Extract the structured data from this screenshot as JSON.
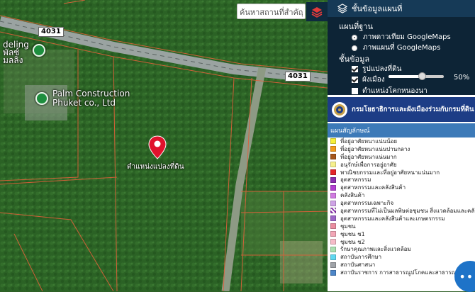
{
  "map": {
    "poi1": "deling\nพัลซ์\nมลลิง",
    "poi2_line1": "Palm Construction",
    "poi2_line2": "Phuket co., Ltd",
    "road_shield_1": "4031",
    "road_shield_2": "4031",
    "marker_label": "ตำแหน่งแปลงที่ดิน",
    "marker_color": "#e0122c"
  },
  "search": {
    "placeholder": "ค้นหาสถานที่สำคัญ"
  },
  "panel": {
    "header_title": "ชั้นข้อมูลแผนที่",
    "basemap_title": "แผนที่ฐาน",
    "basemap_options": [
      "ภาพดาวเทียม GoogleMaps",
      "ภาพแผนที่ GoogleMaps"
    ],
    "basemap_selected": 0,
    "data_title": "ชั้นข้อมูล",
    "layers": [
      {
        "label": "รูปแปลงที่ดิน",
        "checked": true
      },
      {
        "label": "ผังเมือง",
        "checked": true
      },
      {
        "label": "ตำแหน่งโคกหนองนา",
        "checked": false
      }
    ],
    "opacity_value": "50%",
    "opacity_fraction": 0.6,
    "dept_banner": "กรมโยธาธิการและผังเมืองร่วมกับกรมที่ดิน",
    "legend_title": "แผนสัญลักษณ์",
    "legend": [
      {
        "label": "ที่อยู่อาศัยหนาแน่นน้อย",
        "color": "#f6ef3a"
      },
      {
        "label": "ที่อยู่อาศัยหนาแน่นปานกลาง",
        "color": "#f29a1e"
      },
      {
        "label": "ที่อยู่อาศัยหนาแน่นมาก",
        "color": "#a5561b"
      },
      {
        "label": "อนุรักษ์เพื่อการอยู่อาศัย",
        "color": "#f6f08c"
      },
      {
        "label": "พาณิชยกรรมและที่อยู่อาศัยหนาแน่นมาก",
        "color": "#e3262b"
      },
      {
        "label": "อุตสาหกรรม",
        "color": "#8a2fb0"
      },
      {
        "label": "อุตสาหกรรมและคลังสินค้า",
        "color": "#b23fd1"
      },
      {
        "label": "คลังสินค้า",
        "color": "#d07ae0"
      },
      {
        "label": "อุตสาหกรรมเฉพาะกิจ",
        "color": "#cfa3e6"
      },
      {
        "label": "อุตสาหกรรมที่ไม่เป็นมลพิษต่อชุมชน สิ่งแวดล้อมและคลังสินค้า",
        "color": "#c07be0"
      },
      {
        "label": "อุตสาหกรรมและคลังสินค้าและเกษตรกรรม",
        "color": "#9c66c7"
      },
      {
        "label": "ชุมชน",
        "color": "#ea8da0"
      },
      {
        "label": "ชุมชน ช1",
        "color": "#f2a6b6"
      },
      {
        "label": "ชุมชน ช2",
        "color": "#f5bcc8"
      },
      {
        "label": "รักษาคุณภาพและสิ่งแวดล้อม",
        "color": "#a9e0b0"
      },
      {
        "label": "สถาบันการศึกษา",
        "color": "#5fd8f0"
      },
      {
        "label": "สถาบันศาสนา",
        "color": "#9fa3a8"
      },
      {
        "label": "สถาบันราชการ การสาธารณูปโภคและสาธารณูปการ",
        "color": "#4d86c8"
      }
    ]
  },
  "fab_label": "•••"
}
